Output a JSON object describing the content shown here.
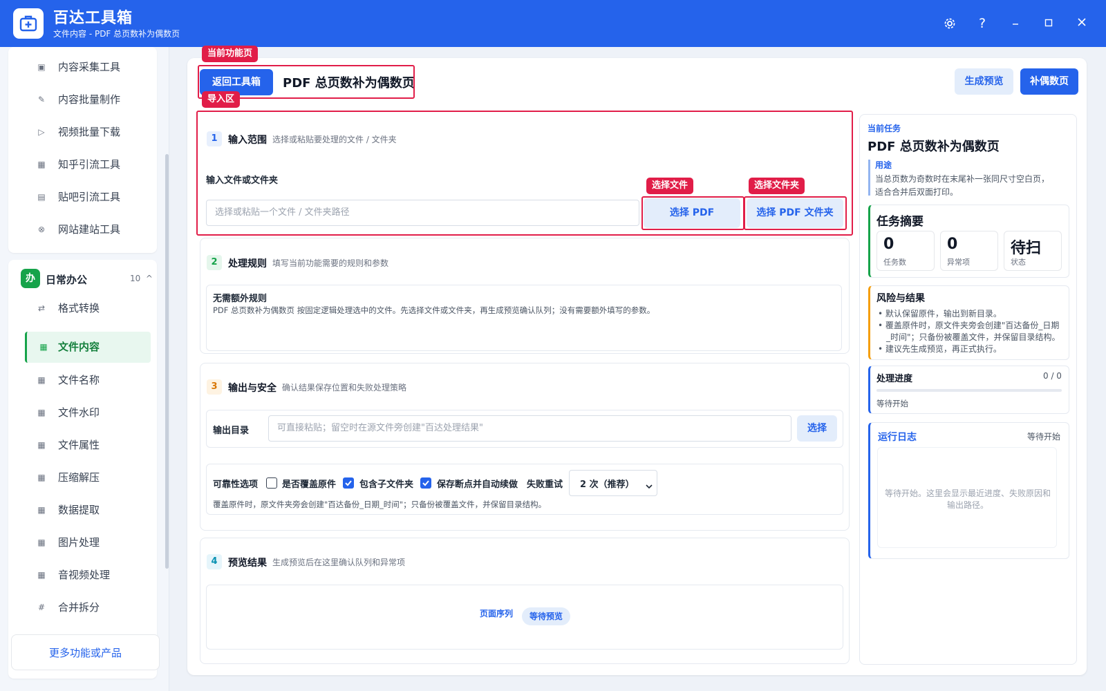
{
  "app": {
    "title": "百达工具箱",
    "subtitle": "文件内容 - PDF 总页数补为偶数页"
  },
  "sidebar": {
    "items_top": [
      {
        "icon": "▣",
        "label": "内容采集工具"
      },
      {
        "icon": "✎",
        "label": "内容批量制作"
      },
      {
        "icon": "▷",
        "label": "视频批量下载"
      },
      {
        "icon": "▦",
        "label": "知乎引流工具"
      },
      {
        "icon": "▤",
        "label": "贴吧引流工具"
      },
      {
        "icon": "⊗",
        "label": "网站建站工具"
      }
    ],
    "group": {
      "badge": "办",
      "name": "日常办公",
      "count": "10",
      "chevron": "^"
    },
    "items_group": [
      {
        "icon": "⇄",
        "label": "格式转换"
      },
      {
        "icon": "▦",
        "label": "文件内容"
      },
      {
        "icon": "▦",
        "label": "文件名称"
      },
      {
        "icon": "▦",
        "label": "文件水印"
      },
      {
        "icon": "▦",
        "label": "文件属性"
      },
      {
        "icon": "▦",
        "label": "压缩解压"
      },
      {
        "icon": "▦",
        "label": "数据提取"
      },
      {
        "icon": "▦",
        "label": "图片处理"
      },
      {
        "icon": "▦",
        "label": "音视频处理"
      },
      {
        "icon": "#",
        "label": "合并拆分"
      }
    ],
    "more_label": "更多功能或产品"
  },
  "header": {
    "back_label": "返回工具箱",
    "page_title": "PDF 总页数补为偶数页",
    "preview_label": "生成预览",
    "run_label": "补偶数页"
  },
  "annotations": {
    "current_page": "当前功能页",
    "import_area": "导入区",
    "select_file": "选择文件",
    "select_folder": "选择文件夹"
  },
  "step1": {
    "num": "1",
    "title": "输入范围",
    "desc": "选择或粘贴要处理的文件 / 文件夹",
    "field_label": "输入文件或文件夹",
    "placeholder": "选择或粘贴一个文件 / 文件夹路径",
    "btn_pdf": "选择 PDF",
    "btn_folder": "选择 PDF 文件夹"
  },
  "step2": {
    "num": "2",
    "title": "处理规则",
    "desc": "填写当前功能需要的规则和参数",
    "rule_title": "无需额外规则",
    "rule_desc": "PDF 总页数补为偶数页 按固定逻辑处理选中的文件。先选择文件或文件夹，再生成预览确认队列；没有需要额外填写的参数。"
  },
  "step3": {
    "num": "3",
    "title": "输出与安全",
    "desc": "确认结果保存位置和失败处理策略",
    "out_label": "输出目录",
    "out_placeholder": "可直接粘贴；留空时在源文件旁创建\"百达处理结果\"",
    "out_btn": "选择",
    "reliability_label": "可靠性选项",
    "opt_overwrite": "是否覆盖原件",
    "opt_subfolder": "包含子文件夹",
    "opt_resume": "保存断点并自动续做",
    "retry_label": "失败重试",
    "retry_value": "2 次（推荐）",
    "note": "覆盖原件时，原文件夹旁会创建\"百达备份_日期_时间\"；只备份被覆盖文件，并保留目录结构。"
  },
  "step4": {
    "num": "4",
    "title": "预览结果",
    "desc": "生成预览后在这里确认队列和异常项",
    "seq_label": "页面序列",
    "status_badge": "等待预览"
  },
  "right": {
    "task_caption": "当前任务",
    "task_title": "PDF 总页数补为偶数页",
    "usage_title": "用途",
    "usage_text_1": "当总页数为奇数时在末尾补一张同尺寸空白页，",
    "usage_text_2": "适合合并后双面打印。",
    "summary_title": "任务摘要",
    "stats": [
      {
        "value": "0",
        "label": "任务数"
      },
      {
        "value": "0",
        "label": "异常项"
      },
      {
        "value": "待扫",
        "label": "状态"
      }
    ],
    "risk_title": "风险与结果",
    "risk_1": "默认保留原件，输出到新目录。",
    "risk_2a": "覆盖原件时，原文件夹旁会创建\"百达备份_日期",
    "risk_2b": "_时间\"；只备份被覆盖文件，并保留目录结构。",
    "risk_3": "建议先生成预览，再正式执行。",
    "progress_title": "处理进度",
    "progress_count": "0 / 0",
    "progress_value": 0,
    "progress_status": "等待开始",
    "log_title": "运行日志",
    "log_status": "等待开始",
    "log_text_1": "等待开始。这里会显示最近进度、失败原因和",
    "log_text_2": "输出路径。"
  },
  "colors": {
    "brand": "#2563eb",
    "annotation": "#e11d48",
    "active_green": "#16a34a",
    "summary_accent": "#16a34a",
    "risk_accent": "#f59e0b",
    "progress_accent": "#2563eb"
  }
}
